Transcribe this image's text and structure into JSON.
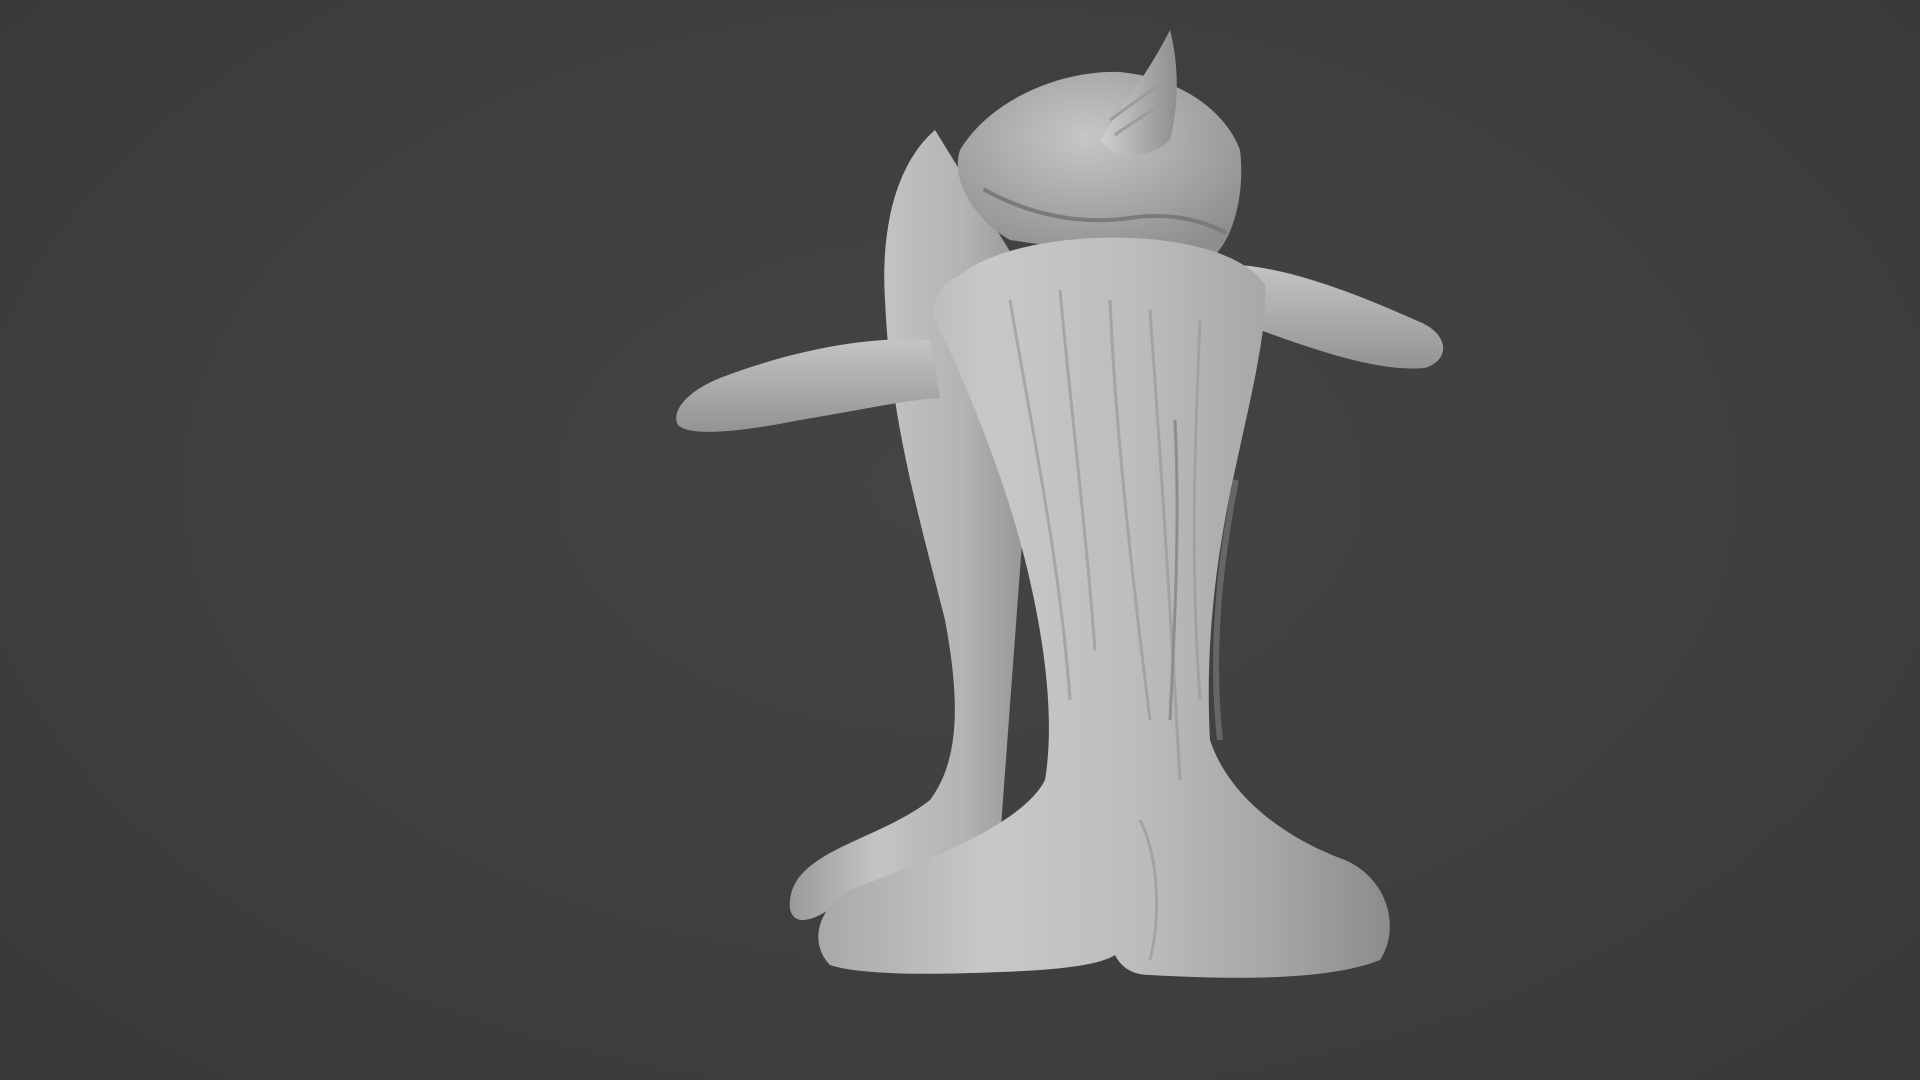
{
  "viewport": {
    "background_color": "#3d3d3d",
    "model_color": "#b8b8b8",
    "object": "sculpted-whale-creature-mesh"
  }
}
